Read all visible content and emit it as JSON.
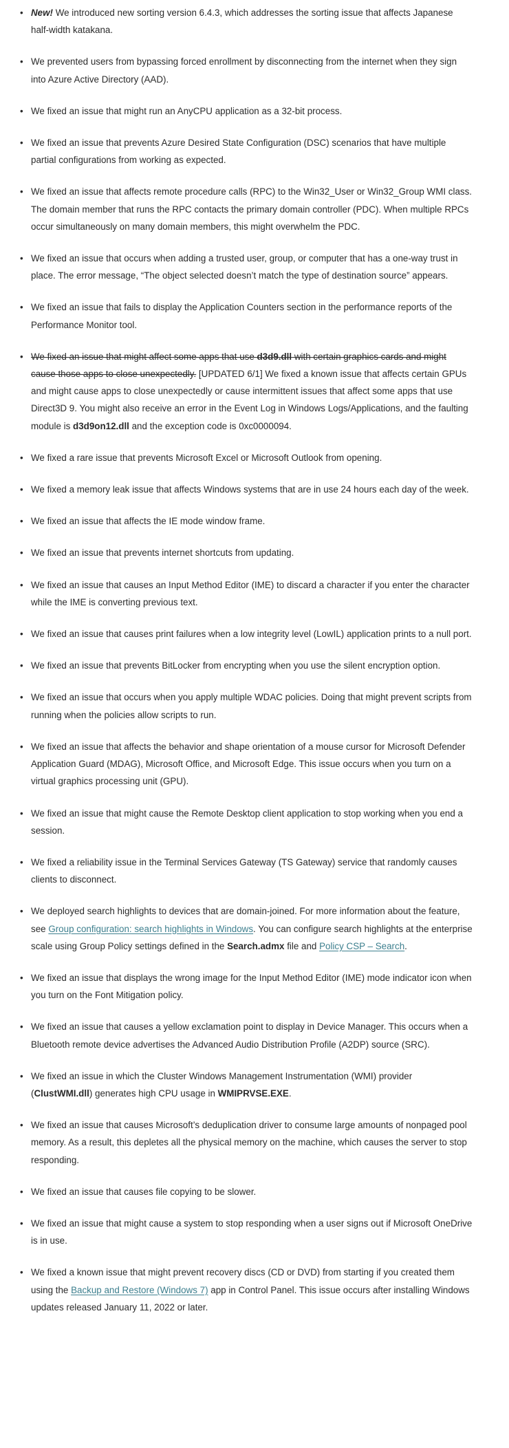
{
  "document": {
    "type": "release-notes-bullet-list",
    "bullet_glyph": "•",
    "colors": {
      "text": "#2b2b2b",
      "link": "#3d7f8e",
      "background": "#ffffff"
    }
  },
  "notes": [
    {
      "id": "sorting-version",
      "segments": [
        {
          "style": "italic-bold",
          "text": "New!"
        },
        {
          "style": "plain",
          "text": " We introduced new sorting version 6.4.3, which addresses the sorting issue that affects Japanese half-width katakana."
        }
      ]
    },
    {
      "id": "forced-enrollment-aad",
      "segments": [
        {
          "style": "plain",
          "text": "We prevented users from bypassing forced enrollment by disconnecting from the internet when they sign into Azure Active Directory (AAD)."
        }
      ]
    },
    {
      "id": "anycpu-32bit",
      "segments": [
        {
          "style": "plain",
          "text": "We fixed an issue that might run an AnyCPU application as a 32-bit process."
        }
      ]
    },
    {
      "id": "azure-dsc-partial-configurations",
      "segments": [
        {
          "style": "plain",
          "text": "We fixed an issue that prevents Azure Desired State Configuration (DSC) scenarios that have multiple partial configurations from working as expected."
        }
      ]
    },
    {
      "id": "rpc-win32-user-group-wmi",
      "segments": [
        {
          "style": "plain",
          "text": "We fixed an issue that affects remote procedure calls (RPC) to the Win32_User or Win32_Group WMI class. The domain member that runs the RPC contacts the primary domain controller (PDC). When multiple RPCs occur simultaneously on many domain members, this might overwhelm the PDC."
        }
      ]
    },
    {
      "id": "one-way-trust-object-selected",
      "segments": [
        {
          "style": "plain",
          "text": "We fixed an issue that occurs when adding a trusted user, group, or computer that has a one-way trust in place. The error message, “The object selected doesn’t match the type of destination source” appears."
        }
      ]
    },
    {
      "id": "application-counters-performance-monitor",
      "segments": [
        {
          "style": "plain",
          "text": "We fixed an issue that fails to display the Application Counters section in the performance reports of the Performance Monitor tool."
        }
      ]
    },
    {
      "id": "d3d9-graphics-cards-updated",
      "segments": [
        {
          "style": "strike",
          "text": "We fixed an issue that might affect some apps that use "
        },
        {
          "style": "strike-bold",
          "text": "d3d9.dll"
        },
        {
          "style": "strike",
          "text": " with certain graphics cards and might cause those apps to close unexpectedly."
        },
        {
          "style": "plain",
          "text": " [UPDATED 6/1] We fixed a known issue that affects certain GPUs and might cause apps to close unexpectedly or cause intermittent issues that affect some apps that use Direct3D 9. You might also receive an error in the Event Log in Windows Logs/Applications, and the faulting module is "
        },
        {
          "style": "bold",
          "text": "d3d9on12.dll"
        },
        {
          "style": "plain",
          "text": " and the exception code is 0xc0000094."
        }
      ]
    },
    {
      "id": "excel-outlook-opening",
      "segments": [
        {
          "style": "plain",
          "text": "We fixed a rare issue that prevents Microsoft Excel or Microsoft Outlook from opening."
        }
      ]
    },
    {
      "id": "memory-leak-24-hours",
      "segments": [
        {
          "style": "plain",
          "text": "We fixed a memory leak issue that affects Windows systems that are in use 24 hours each day of the week."
        }
      ]
    },
    {
      "id": "ie-mode-window-frame",
      "segments": [
        {
          "style": "plain",
          "text": "We fixed an issue that affects the IE mode window frame."
        }
      ]
    },
    {
      "id": "internet-shortcuts-updating",
      "segments": [
        {
          "style": "plain",
          "text": "We fixed an issue that prevents internet shortcuts from updating."
        }
      ]
    },
    {
      "id": "ime-discard-character",
      "segments": [
        {
          "style": "plain",
          "text": "We fixed an issue that causes an Input Method Editor (IME) to discard a character if you enter the character while the IME is converting previous text."
        }
      ]
    },
    {
      "id": "print-failures-lowil",
      "segments": [
        {
          "style": "plain",
          "text": "We fixed an issue that causes print failures when a low integrity level (LowIL) application prints to a null port."
        }
      ]
    },
    {
      "id": "bitlocker-silent-encryption",
      "segments": [
        {
          "style": "plain",
          "text": "We fixed an issue that prevents BitLocker from encrypting when you use the silent encryption option."
        }
      ]
    },
    {
      "id": "wdac-multiple-policies",
      "segments": [
        {
          "style": "plain",
          "text": "We fixed an issue that occurs when you apply multiple WDAC policies. Doing that might prevent scripts from running when the policies allow scripts to run."
        }
      ]
    },
    {
      "id": "mdag-mouse-cursor-gpu",
      "segments": [
        {
          "style": "plain",
          "text": "We fixed an issue that affects the behavior and shape orientation of a mouse cursor for Microsoft Defender Application Guard (MDAG), Microsoft Office, and Microsoft Edge. This issue occurs when you turn on a virtual graphics processing unit (GPU)."
        }
      ]
    },
    {
      "id": "remote-desktop-client-stop-working",
      "segments": [
        {
          "style": "plain",
          "text": "We fixed an issue that might cause the Remote Desktop client application to stop working when you end a session."
        }
      ]
    },
    {
      "id": "ts-gateway-reliability",
      "segments": [
        {
          "style": "plain",
          "text": "We fixed a reliability issue in the Terminal Services Gateway (TS Gateway) service that randomly causes clients to disconnect."
        }
      ]
    },
    {
      "id": "search-highlights-domain-joined",
      "segments": [
        {
          "style": "plain",
          "text": "We deployed search highlights to devices that are domain-joined. For more information about the feature, see "
        },
        {
          "style": "link",
          "text": "Group configuration: search highlights in Windows"
        },
        {
          "style": "plain",
          "text": ". You can configure search highlights at the enterprise scale using Group Policy settings defined in the "
        },
        {
          "style": "bold",
          "text": "Search.admx"
        },
        {
          "style": "plain",
          "text": " file and "
        },
        {
          "style": "link",
          "text": "Policy CSP – Search"
        },
        {
          "style": "plain",
          "text": "."
        }
      ]
    },
    {
      "id": "ime-mode-indicator-font-mitigation",
      "segments": [
        {
          "style": "plain",
          "text": "We fixed an issue that displays the wrong image for the Input Method Editor (IME) mode indicator icon when you turn on the Font Mitigation policy."
        }
      ]
    },
    {
      "id": "bluetooth-a2dp-device-manager",
      "segments": [
        {
          "style": "plain",
          "text": "We fixed an issue that causes a yellow exclamation point to display in Device Manager. This occurs when a Bluetooth remote device advertises the Advanced Audio Distribution Profile (A2DP) source (SRC)."
        }
      ]
    },
    {
      "id": "clustwmi-high-cpu",
      "segments": [
        {
          "style": "plain",
          "text": "We fixed an issue in which the Cluster Windows Management Instrumentation (WMI) provider ("
        },
        {
          "style": "bold",
          "text": "ClustWMI.dll"
        },
        {
          "style": "plain",
          "text": ") generates high CPU usage in "
        },
        {
          "style": "bold",
          "text": "WMIPRVSE.EXE"
        },
        {
          "style": "plain",
          "text": "."
        }
      ]
    },
    {
      "id": "deduplication-driver-nonpaged-pool",
      "segments": [
        {
          "style": "plain",
          "text": "We fixed an issue that causes Microsoft’s deduplication driver to consume large amounts of nonpaged pool memory. As a result, this depletes all the physical memory on the machine, which causes the server to stop responding."
        }
      ]
    },
    {
      "id": "file-copying-slower",
      "segments": [
        {
          "style": "plain",
          "text": "We fixed an issue that causes file copying to be slower."
        }
      ]
    },
    {
      "id": "onedrive-sign-out-stop-responding",
      "segments": [
        {
          "style": "plain",
          "text": "We fixed an issue that might cause a system to stop responding when a user signs out if Microsoft OneDrive is in use."
        }
      ]
    },
    {
      "id": "recovery-discs-backup-restore",
      "segments": [
        {
          "style": "plain",
          "text": "We fixed a known issue that might prevent recovery discs (CD or DVD) from starting if you created them using the "
        },
        {
          "style": "link",
          "text": "Backup and Restore (Windows 7)"
        },
        {
          "style": "plain",
          "text": " app in Control Panel. This issue occurs after installing Windows updates released January 11, 2022 or later."
        }
      ]
    }
  ]
}
